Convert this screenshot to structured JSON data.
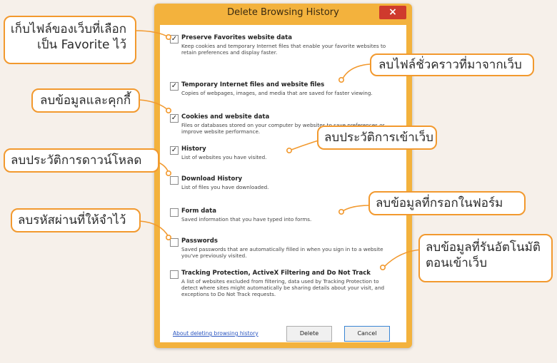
{
  "dialog": {
    "title": "Delete Browsing History",
    "close_glyph": "×",
    "options": [
      {
        "title": "Preserve Favorites website data",
        "checked": true,
        "desc": "Keep cookies and temporary Internet files that enable your favorite websites to retain preferences and display faster."
      },
      {
        "title": "Temporary Internet files and website files",
        "checked": true,
        "desc": "Copies of webpages, images, and media that are saved for faster viewing."
      },
      {
        "title": "Cookies and website data",
        "checked": true,
        "desc": "Files or databases stored on your computer by websites to save preferences or improve website performance."
      },
      {
        "title": "History",
        "checked": true,
        "desc": "List of websites you have visited."
      },
      {
        "title": "Download History",
        "checked": false,
        "desc": "List of files you have downloaded."
      },
      {
        "title": "Form data",
        "checked": false,
        "desc": "Saved information that you have typed into forms."
      },
      {
        "title": "Passwords",
        "checked": false,
        "desc": "Saved passwords that are automatically filled in when you sign in to a website you've previously visited."
      },
      {
        "title": "Tracking Protection, ActiveX Filtering and Do Not Track",
        "checked": false,
        "desc": "A list of websites excluded from filtering, data used by Tracking Protection to detect where sites might automatically be sharing details about your visit, and exceptions to Do Not Track requests."
      }
    ],
    "footer_link": "About deleting browsing history",
    "delete_label": "Delete",
    "cancel_label": "Cancel",
    "check_glyph": "✓"
  },
  "callouts": {
    "preserve_line1": "เก็บไฟล์ของเว็บที่เลือก",
    "preserve_line2": "เป็น Favorite ไว้",
    "temp_files": "ลบไฟล์ชั่วคราวที่มาจากเว็บ",
    "cookies": "ลบข้อมูลและคุกกี้",
    "history": "ลบประวัติการเข้าเว็บ",
    "downloads": "ลบประวัติการดาวน์โหลด",
    "form_data": "ลบข้อมูลที่กรอกในฟอร์ม",
    "passwords": "ลบรหัสผ่านที่ให้จำไว้",
    "tracking_line1": "ลบข้อมูลที่รันอัตโนมัติ",
    "tracking_line2": "ตอนเข้าเว็บ"
  },
  "colors": {
    "accent": "#f2992e",
    "dialog_frame": "#f3b23d",
    "close": "#cf3a2d"
  }
}
